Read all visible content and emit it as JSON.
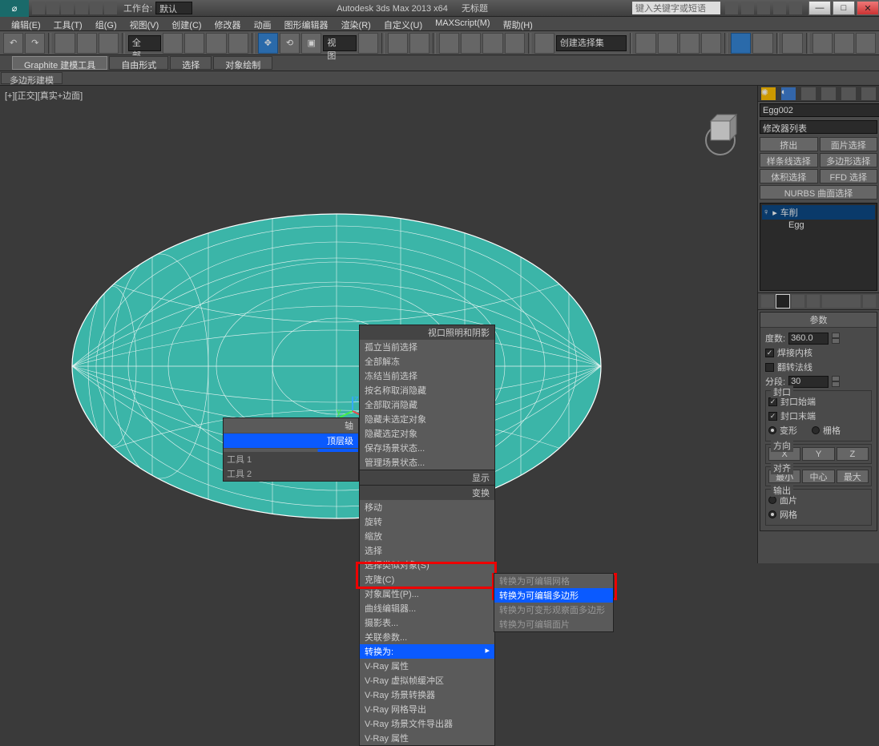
{
  "titlebar": {
    "workspace_label": "工作台:",
    "workspace_value": "默认",
    "app_title": "Autodesk 3ds Max  2013 x64",
    "doc_title": "无标题",
    "search_placeholder": "键入关键字或短语"
  },
  "menubar": [
    "编辑(E)",
    "工具(T)",
    "组(G)",
    "视图(V)",
    "创建(C)",
    "修改器",
    "动画",
    "图形编辑器",
    "渲染(R)",
    "自定义(U)",
    "MAXScript(M)",
    "帮助(H)"
  ],
  "toolbar": {
    "filter_all": "全部",
    "view_sel": "视图",
    "sel_set": "创建选择集"
  },
  "ribbon_tabs": [
    "Graphite 建模工具",
    "自由形式",
    "选择",
    "对象绘制"
  ],
  "ribbon2": [
    "多边形建模"
  ],
  "viewport": {
    "label": "[+][正交][真实+边面]"
  },
  "quad_left": {
    "axis": "轴",
    "top_level": "顶层级",
    "tool1": "工具 1",
    "tool2": "工具 2"
  },
  "ctx": {
    "hdr1": "视口照明和阴影",
    "items1": [
      "孤立当前选择",
      "全部解冻",
      "冻结当前选择",
      "按名称取消隐藏",
      "全部取消隐藏",
      "隐藏未选定对象",
      "隐藏选定对象",
      "保存场景状态...",
      "管理场景状态..."
    ],
    "hdr2": "显示",
    "hdr3": "变换",
    "items2": [
      "移动",
      "旋转",
      "缩放",
      "选择",
      "选择类似对象(S)",
      "克隆(C)",
      "对象属性(P)...",
      "曲线编辑器...",
      "摄影表...",
      "关联参数..."
    ],
    "convert": "转换为:",
    "items3": [
      "V-Ray 属性",
      "V-Ray 虚拟帧缓冲区",
      "V-Ray 场景转换器",
      "V-Ray 网格导出",
      "V-Ray 场景文件导出器",
      "V-Ray 属性"
    ]
  },
  "submenu": {
    "items": [
      "转换为可编辑网格",
      "转换为可编辑多边形",
      "转换为可变形观察面多边形",
      "转换为可编辑面片"
    ],
    "hl_index": 1
  },
  "side": {
    "obj_name": "Egg002",
    "mod_list": "修改器列表",
    "buttons": [
      "挤出",
      "面片选择",
      "样条线选择",
      "多边形选择",
      "体积选择",
      "FFD 选择"
    ],
    "nurbs": "NURBS 曲面选择",
    "stack": [
      "车削",
      "Egg"
    ],
    "rollout_title": "参数",
    "degrees_label": "度数:",
    "degrees_val": "360.0",
    "weld_core": "焊接内核",
    "flip_normals": "翻转法线",
    "segments_label": "分段:",
    "segments_val": "30",
    "cap": {
      "legend": "封口",
      "start": "封口始端",
      "end": "封口末端",
      "morph": "变形",
      "grid": "栅格"
    },
    "direction": {
      "legend": "方向",
      "x": "X",
      "y": "Y",
      "z": "Z"
    },
    "align": {
      "legend": "对齐",
      "min": "最小",
      "center": "中心",
      "max": "最大"
    },
    "output": {
      "legend": "输出",
      "patch": "面片",
      "mesh": "网格"
    }
  }
}
